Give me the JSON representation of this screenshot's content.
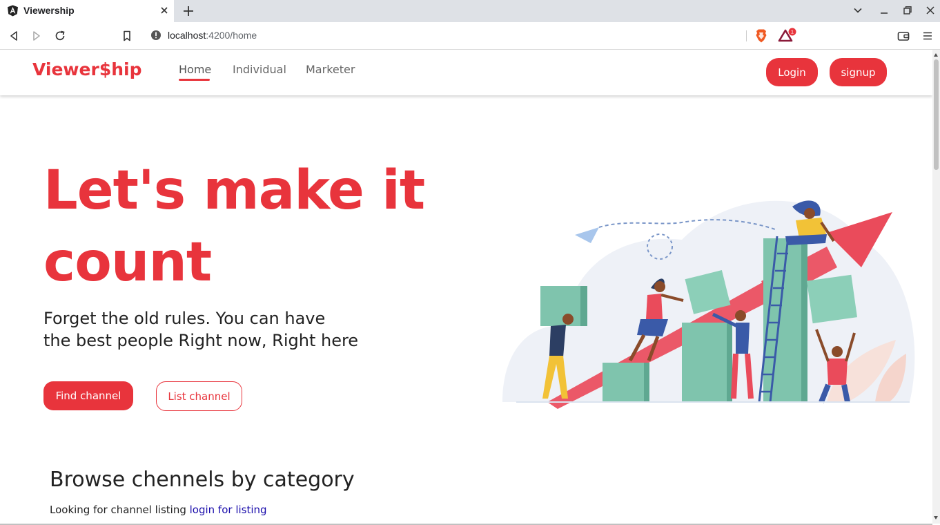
{
  "browser": {
    "tab_title": "Viewership",
    "url_host": "localhost",
    "url_path": ":4200/home",
    "brave_badge_count": "1"
  },
  "navbar": {
    "logo": "Viewer$hip",
    "links": [
      "Home",
      "Individual",
      "Marketer"
    ],
    "active_link": "Home",
    "login_label": "Login",
    "signup_label": "signup"
  },
  "hero": {
    "title": "Let's make it count",
    "subtitle_line1": "Forget the old rules. You can have",
    "subtitle_line2": "the best people Right now, Right here",
    "find_button": "Find channel",
    "list_button": "List channel"
  },
  "browse": {
    "title": "Browse chennels by category",
    "text": "Looking for channel listing",
    "link": "login for listing"
  },
  "colors": {
    "accent": "#e8343c",
    "teal": "#7fc4ad",
    "link": "#1a0dab"
  }
}
